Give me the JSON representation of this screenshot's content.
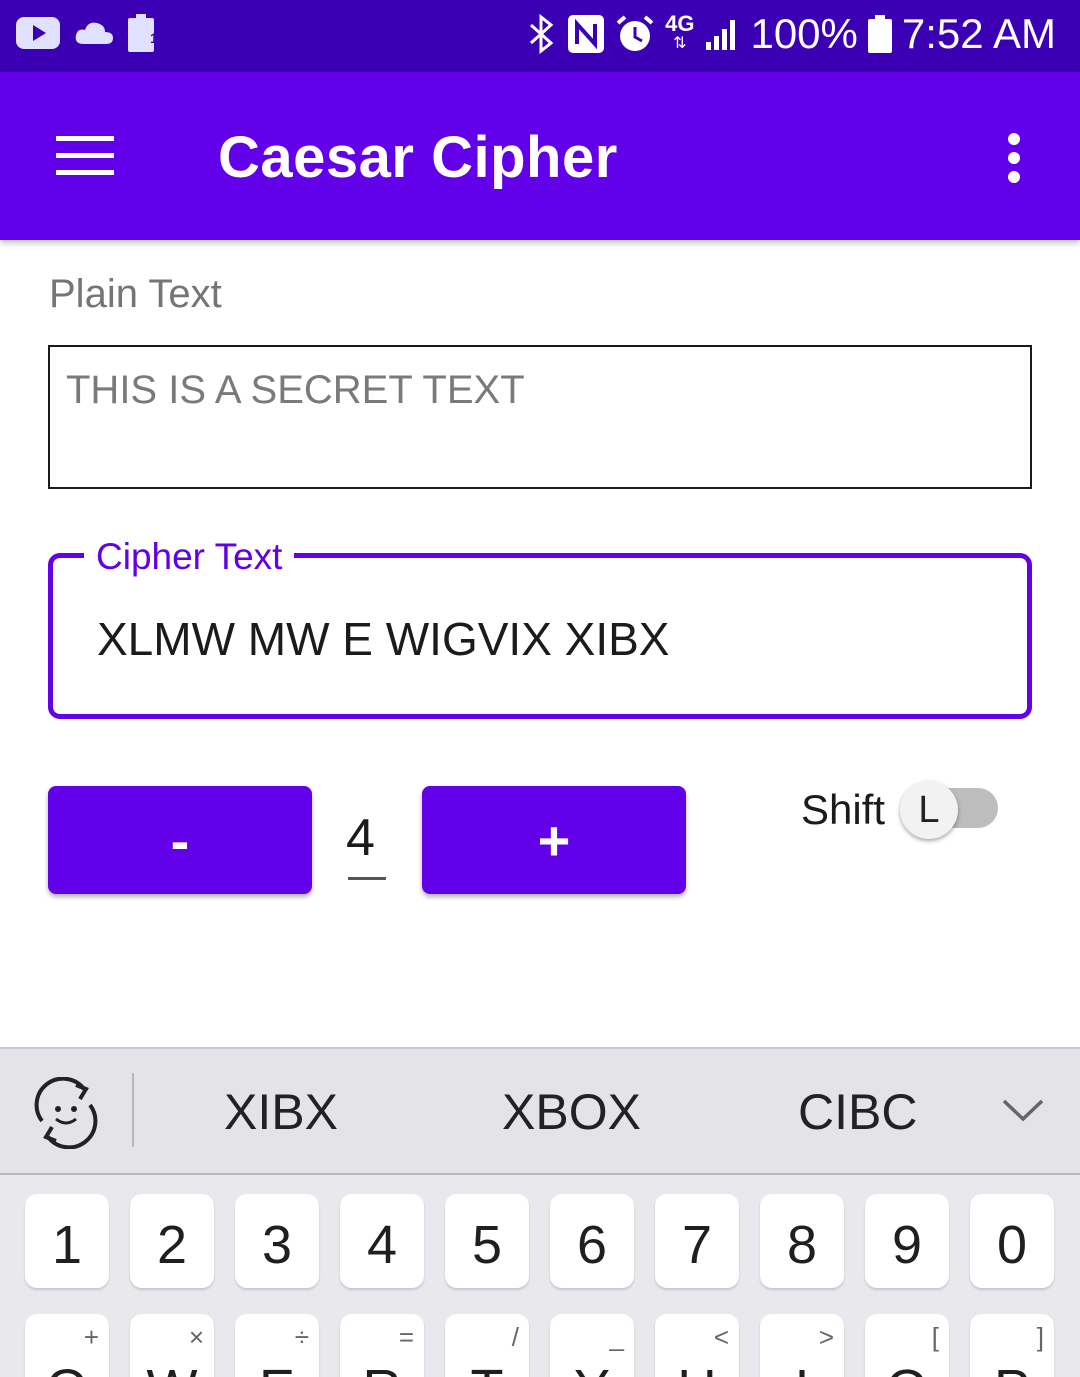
{
  "status_bar": {
    "battery_badge": "100",
    "network": "4G",
    "battery_percent": "100%",
    "time": "7:52 AM"
  },
  "app_bar": {
    "title": "Caesar Cipher"
  },
  "plain_text": {
    "label": "Plain Text",
    "placeholder": "THIS IS A SECRET TEXT",
    "value": ""
  },
  "cipher_text": {
    "label": "Cipher Text",
    "value": "XLMW MW E WIGVIX XIBX"
  },
  "shift_controls": {
    "minus_label": "-",
    "plus_label": "+",
    "value": "4",
    "toggle_label": "Shift",
    "toggle_thumb": "L"
  },
  "keyboard": {
    "suggestions": [
      "XIBX",
      "XBOX",
      "CIBC"
    ],
    "number_row": [
      "1",
      "2",
      "3",
      "4",
      "5",
      "6",
      "7",
      "8",
      "9",
      "0"
    ],
    "letter_row": [
      {
        "key": "Q",
        "sub": "+"
      },
      {
        "key": "W",
        "sub": "×"
      },
      {
        "key": "E",
        "sub": "÷"
      },
      {
        "key": "R",
        "sub": "="
      },
      {
        "key": "T",
        "sub": "/"
      },
      {
        "key": "Y",
        "sub": "_"
      },
      {
        "key": "U",
        "sub": "<"
      },
      {
        "key": "I",
        "sub": ">"
      },
      {
        "key": "O",
        "sub": "["
      },
      {
        "key": "P",
        "sub": "]"
      }
    ]
  },
  "colors": {
    "status_bar": "#3b00b3",
    "primary": "#6200ea"
  }
}
